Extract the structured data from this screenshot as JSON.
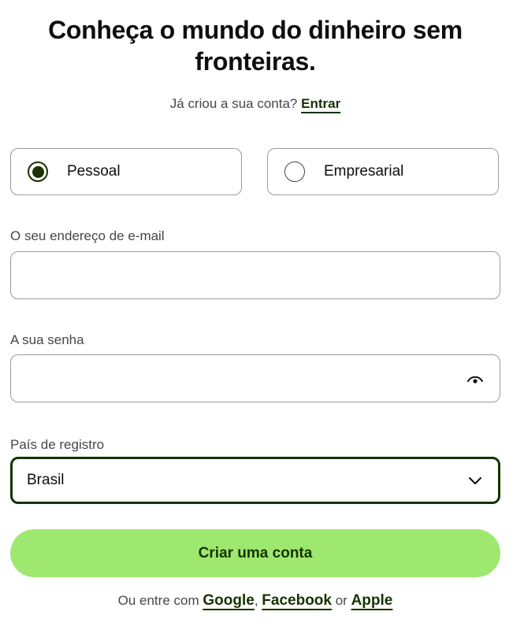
{
  "header": {
    "title_line1": "Conheça o mundo do dinheiro sem",
    "title_line2": "fronteiras.",
    "signin_prompt": "Já criou a sua conta?",
    "signin_link": "Entrar"
  },
  "account_type": {
    "options": [
      {
        "label": "Pessoal",
        "selected": true
      },
      {
        "label": "Empresarial",
        "selected": false
      }
    ]
  },
  "form": {
    "email_label": "O seu endereço de e-mail",
    "email_value": "",
    "password_label": "A sua senha",
    "password_value": "",
    "country_label": "País de registro",
    "country_value": "Brasil"
  },
  "actions": {
    "create_account_label": "Criar uma conta"
  },
  "social": {
    "prefix": "Ou entre com",
    "google": "Google",
    "separator": ",",
    "facebook": "Facebook",
    "or": "or",
    "apple": "Apple"
  },
  "colors": {
    "primary_green": "#9fe870",
    "dark_green": "#163300",
    "text": "#0e0f0c",
    "muted_text": "#454745",
    "border": "#9a9c99"
  },
  "icons": {
    "password_toggle": "eye-icon",
    "select_arrow": "chevron-down-icon",
    "radio_selected": "radio-checked-icon",
    "radio_unselected": "radio-unchecked-icon"
  }
}
